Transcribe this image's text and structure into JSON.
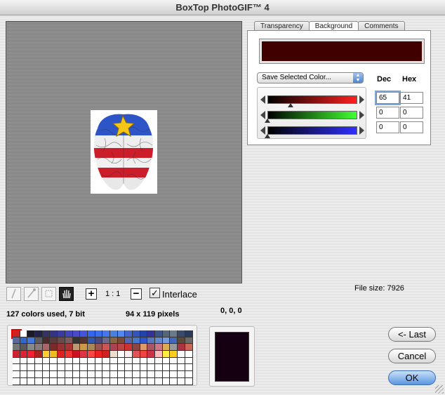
{
  "window": {
    "title": "BoxTop PhotoGIF™ 4"
  },
  "tabs": [
    {
      "label": "Transparency",
      "active": false
    },
    {
      "label": "Background",
      "active": true
    },
    {
      "label": "Comments",
      "active": false
    }
  ],
  "background": {
    "color": "#410000",
    "popup_label": "Save Selected Color...",
    "dec_label": "Dec",
    "hex_label": "Hex",
    "channels": [
      {
        "name": "red",
        "dec": "65",
        "hex": "41",
        "level": 0.255,
        "gradient_end": "#ff2020"
      },
      {
        "name": "green",
        "dec": "0",
        "hex": "0",
        "level": 0.0,
        "gradient_end": "#40ff30"
      },
      {
        "name": "blue",
        "dec": "0",
        "hex": "0",
        "level": 0.0,
        "gradient_end": "#3030ff"
      }
    ]
  },
  "toolbar": {
    "tools": [
      "brush-icon",
      "eyedropper-icon",
      "marquee-icon",
      "hand-icon"
    ],
    "zoom_in": "+",
    "zoom_level": "1 : 1",
    "zoom_out": "−",
    "interlace_label": "Interlace",
    "interlace_checked": true,
    "check_mark": "✓"
  },
  "info": {
    "file_size": "File size: 7926",
    "colors_used": "127 colors used, 7 bit",
    "dimensions": "94 x 119 pixels",
    "rgb_readout": "0, 0, 0"
  },
  "preview_color": "#140010",
  "buttons": {
    "last": "<- Last",
    "cancel": "Cancel",
    "ok": "OK"
  },
  "palette": {
    "rows": [
      [
        "#cc2222",
        "#ffffff",
        "#1a1a2a",
        "#22224a",
        "#333366",
        "#333388",
        "#3a3aa0",
        "#4444bb",
        "#4a4ac8",
        "#4455dd",
        "#3366ee",
        "#3a6fe8",
        "#4477ee",
        "#4a7fe0",
        "#5588ee",
        "#4466cc",
        "#3355bb",
        "#2244aa",
        "#333399",
        "#3a5588",
        "#556677",
        "#6a7a8a",
        "#3a4a6a",
        "#2a3a5a"
      ],
      [
        "#5a6a9a",
        "#3366cc",
        "#4477dd",
        "#5a5a5a",
        "#4a2a2a",
        "#5a3a3a",
        "#6a4a4a",
        "#7a5a5a",
        "#333333",
        "#553333",
        "#3355aa",
        "#4a4a7a",
        "#6a6a8a",
        "#886644",
        "#7a4a3a",
        "#5566aa",
        "#4477cc",
        "#3355cc",
        "#5577bb",
        "#6688cc",
        "#7799dd",
        "#4466bb",
        "#5a4a3a",
        "#6a6a6a"
      ],
      [
        "#777777",
        "#5a5a5a",
        "#888888",
        "#8a7a7a",
        "#aa6666",
        "#7a2a2a",
        "#993333",
        "#aa3333",
        "#bb9977",
        "#cc9944",
        "#aa8855",
        "#995555",
        "#cc5555",
        "#aa4455",
        "#bb4444",
        "#cc3333",
        "#8a4444",
        "#dd9966",
        "#aa5566",
        "#cc7788",
        "#ddaa55",
        "#999999",
        "#aa3344",
        "#cc6655"
      ],
      [
        "#cc2233",
        "#dd2233",
        "#ee2233",
        "#aa2222",
        "#ffcc33",
        "#eebb22",
        "#dd2222",
        "#ee3333",
        "#cc1122",
        "#dd3344",
        "#ff4444",
        "#ee2222",
        "#cc2222",
        "#eeddcc",
        "#ffffff",
        "#ffeeee",
        "#dd5555",
        "#ee4444",
        "#cc3344",
        "#ffbbbb",
        "#ffee44",
        "#ffcc22",
        "#ffffff",
        "#ffffff"
      ]
    ],
    "empty_rows": 4,
    "selected_index": 0
  }
}
